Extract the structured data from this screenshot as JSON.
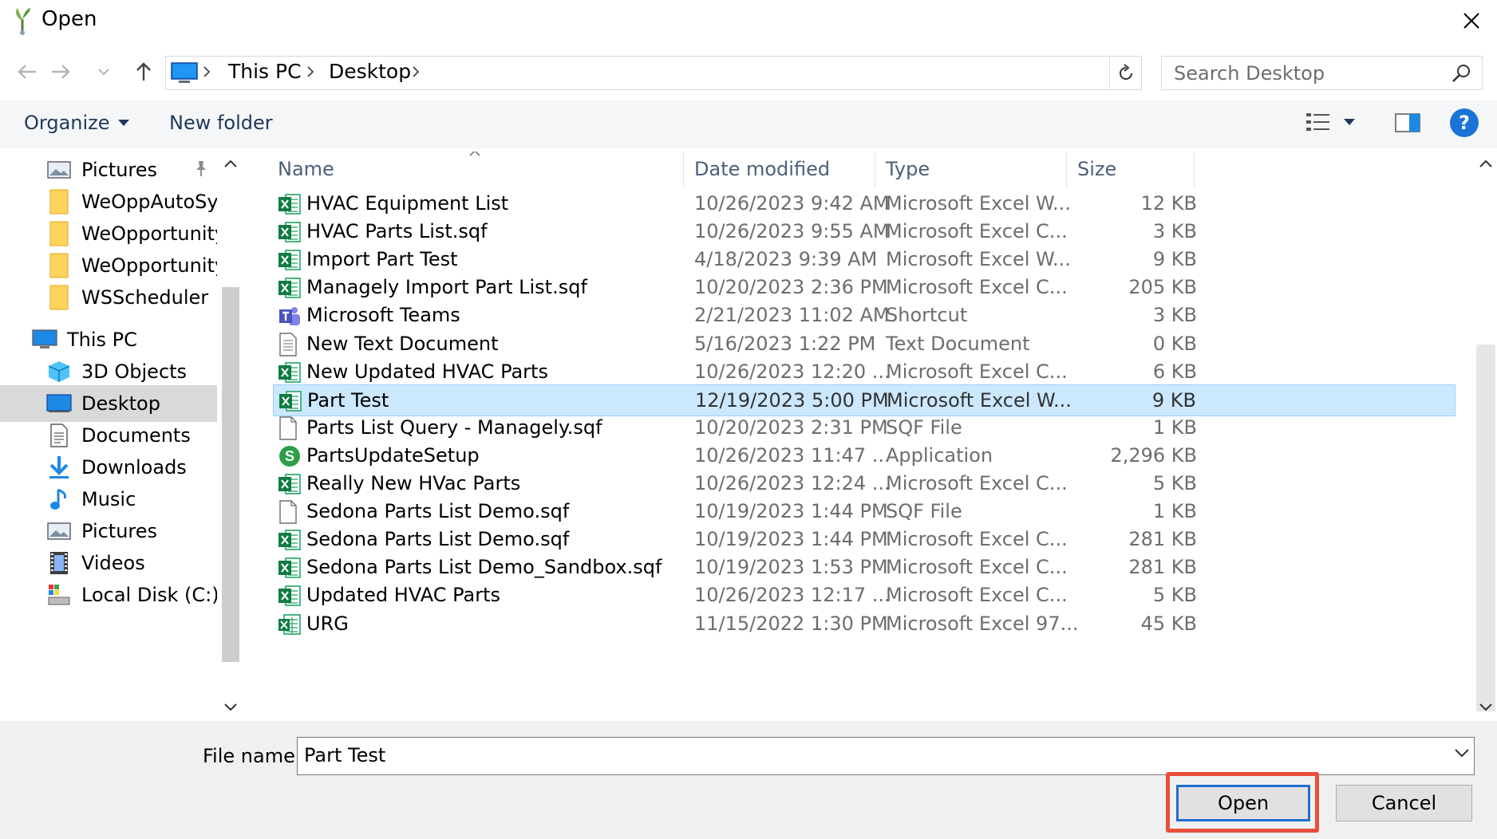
{
  "window": {
    "title": "Open"
  },
  "address": {
    "crumbs": [
      "This PC",
      "Desktop"
    ]
  },
  "search": {
    "placeholder": "Search Desktop"
  },
  "toolbar": {
    "organize": "Organize",
    "new_folder": "New folder",
    "help": "?"
  },
  "nav": {
    "items": [
      {
        "label": "Pictures",
        "icon": "pictures-icon",
        "pinned": true
      },
      {
        "label": "WeOppAutoSyn",
        "icon": "folder-icon"
      },
      {
        "label": "WeOpportunity",
        "icon": "folder-icon"
      },
      {
        "label": "WeOpportunity_",
        "icon": "folder-icon"
      },
      {
        "label": "WSScheduler",
        "icon": "folder-icon"
      },
      {
        "label": "This PC",
        "icon": "this-pc-icon"
      },
      {
        "label": "3D Objects",
        "icon": "3d-objects-icon"
      },
      {
        "label": "Desktop",
        "icon": "desktop-icon",
        "selected": true
      },
      {
        "label": "Documents",
        "icon": "documents-icon"
      },
      {
        "label": "Downloads",
        "icon": "downloads-icon"
      },
      {
        "label": "Music",
        "icon": "music-icon"
      },
      {
        "label": "Pictures",
        "icon": "pictures-icon"
      },
      {
        "label": "Videos",
        "icon": "videos-icon"
      },
      {
        "label": "Local Disk (C:)",
        "icon": "local-disk-icon"
      }
    ]
  },
  "columns": {
    "name": "Name",
    "date": "Date modified",
    "type": "Type",
    "size": "Size"
  },
  "files": [
    {
      "name": "HVAC Equipment List",
      "date": "10/26/2023 9:42 AM",
      "type": "Microsoft Excel W...",
      "size": "12 KB",
      "icon": "excel-icon"
    },
    {
      "name": "HVAC Parts List.sqf",
      "date": "10/26/2023 9:55 AM",
      "type": "Microsoft Excel C...",
      "size": "3 KB",
      "icon": "excel-icon"
    },
    {
      "name": "Import Part Test",
      "date": "4/18/2023 9:39 AM",
      "type": "Microsoft Excel W...",
      "size": "9 KB",
      "icon": "excel-icon"
    },
    {
      "name": "Managely Import Part List.sqf",
      "date": "10/20/2023 2:36 PM",
      "type": "Microsoft Excel C...",
      "size": "205 KB",
      "icon": "excel-icon"
    },
    {
      "name": "Microsoft Teams",
      "date": "2/21/2023 11:02 AM",
      "type": "Shortcut",
      "size": "3 KB",
      "icon": "teams-icon"
    },
    {
      "name": "New Text Document",
      "date": "5/16/2023 1:22 PM",
      "type": "Text Document",
      "size": "0 KB",
      "icon": "text-document-icon"
    },
    {
      "name": "New Updated HVAC Parts",
      "date": "10/26/2023 12:20 ...",
      "type": "Microsoft Excel C...",
      "size": "6 KB",
      "icon": "excel-icon"
    },
    {
      "name": "Part Test",
      "date": "12/19/2023 5:00 PM",
      "type": "Microsoft Excel W...",
      "size": "9 KB",
      "icon": "excel-icon",
      "selected": true
    },
    {
      "name": "Parts List Query - Managely.sqf",
      "date": "10/20/2023 2:31 PM",
      "type": "SQF File",
      "size": "1 KB",
      "icon": "blank-file-icon"
    },
    {
      "name": "PartsUpdateSetup",
      "date": "10/26/2023 11:47 ...",
      "type": "Application",
      "size": "2,296 KB",
      "icon": "setup-app-icon"
    },
    {
      "name": "Really New HVac Parts",
      "date": "10/26/2023 12:24 ...",
      "type": "Microsoft Excel C...",
      "size": "5 KB",
      "icon": "excel-icon"
    },
    {
      "name": "Sedona Parts List Demo.sqf",
      "date": "10/19/2023 1:44 PM",
      "type": "SQF File",
      "size": "1 KB",
      "icon": "blank-file-icon"
    },
    {
      "name": "Sedona Parts List Demo.sqf",
      "date": "10/19/2023 1:44 PM",
      "type": "Microsoft Excel C...",
      "size": "281 KB",
      "icon": "excel-icon"
    },
    {
      "name": "Sedona Parts List Demo_Sandbox.sqf",
      "date": "10/19/2023 1:53 PM",
      "type": "Microsoft Excel C...",
      "size": "281 KB",
      "icon": "excel-icon"
    },
    {
      "name": "Updated HVAC Parts",
      "date": "10/26/2023 12:17 ...",
      "type": "Microsoft Excel C...",
      "size": "5 KB",
      "icon": "excel-icon"
    },
    {
      "name": "URG",
      "date": "11/15/2022 1:30 PM",
      "type": "Microsoft Excel 97...",
      "size": "45 KB",
      "icon": "excel-97-icon"
    }
  ],
  "footer": {
    "file_name_label": "File name:",
    "file_name_value": "Part Test",
    "open_label": "Open",
    "cancel_label": "Cancel"
  },
  "colors": {
    "accent": "#1f6fd0",
    "selection": "#cce8ff",
    "highlight": "#e94e3a"
  }
}
